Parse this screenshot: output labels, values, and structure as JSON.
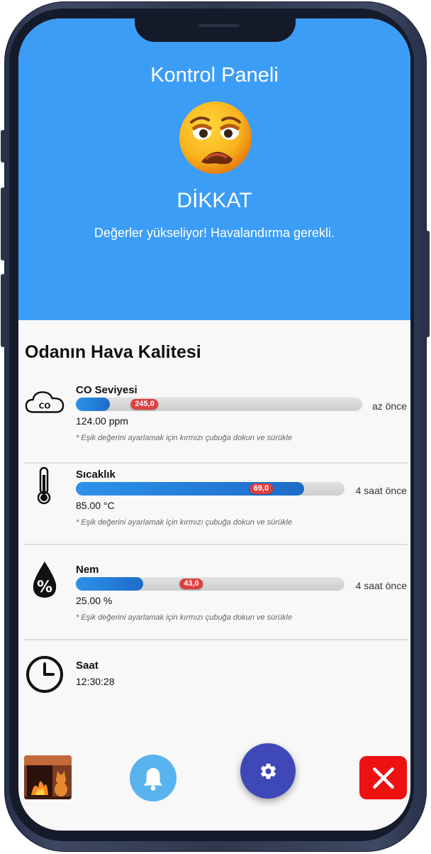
{
  "header": {
    "title": "Kontrol Paneli",
    "emoji_icon": "worried-face-icon",
    "status": "DİKKAT",
    "message": "Değerler yükseliyor! Havalandırma gerekli.",
    "background": "#3c9df6"
  },
  "section": {
    "title": "Odanın Hava Kalitesi"
  },
  "sensors": [
    {
      "icon": "co-cloud-icon",
      "label": "CO Seviyesi",
      "fill_percent": 12,
      "threshold": "245,0",
      "threshold_percent": 24,
      "value": "124.00 ppm",
      "time": "az önce",
      "hint": "* Eşik değerini ayarlamak için kırmızı çubuğa dokun ve sürükle"
    },
    {
      "icon": "thermometer-icon",
      "label": "Sıcaklık",
      "fill_percent": 85,
      "threshold": "69,0",
      "threshold_percent": 69,
      "value": "85.00 °C",
      "time": "4 saat önce",
      "hint": "* Eşik değerini ayarlamak için kırmızı çubuğa dokun ve sürükle"
    },
    {
      "icon": "humidity-drop-icon",
      "label": "Nem",
      "fill_percent": 25,
      "threshold": "43,0",
      "threshold_percent": 43,
      "value": "25.00 %",
      "time": "4 saat önce",
      "hint": "* Eşik değerini ayarlamak için kırmızı çubuğa dokun ve sürükle"
    }
  ],
  "clock": {
    "icon": "clock-icon",
    "label": "Saat",
    "value": "12:30:28"
  },
  "bottom_bar": {
    "image_icon": "fireplace-cat-image",
    "bell_icon": "bell-icon",
    "settings_icon": "gear-icon",
    "close_icon": "close-icon"
  },
  "colors": {
    "accent": "#3c9df6",
    "fab": "#3f48b7",
    "danger": "#ee1111",
    "threshold": "#e03f3f"
  }
}
